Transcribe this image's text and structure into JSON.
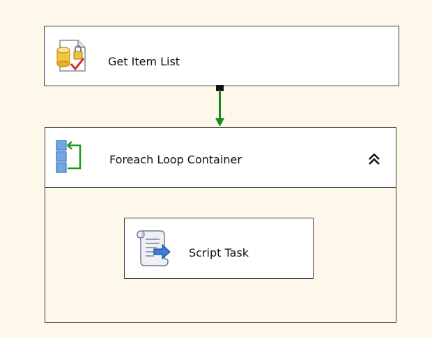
{
  "tasks": {
    "get_item_list": {
      "label": "Get Item List",
      "icon": "sql-task-icon"
    },
    "foreach_container": {
      "label": "Foreach Loop Container",
      "icon": "foreach-loop-icon",
      "collapse_icon": "collapse-chevron-up-icon",
      "expanded": true
    },
    "script_task": {
      "label": "Script Task",
      "icon": "script-task-icon"
    }
  },
  "precedence_constraint": {
    "from": "Get Item List",
    "to": "Foreach Loop Container",
    "status": "success",
    "color": "#1a8a1a"
  },
  "colors": {
    "canvas": "#fdf8e9",
    "box": "#ffffff",
    "border": "#3c3c3c",
    "success": "#1a8a1a"
  }
}
